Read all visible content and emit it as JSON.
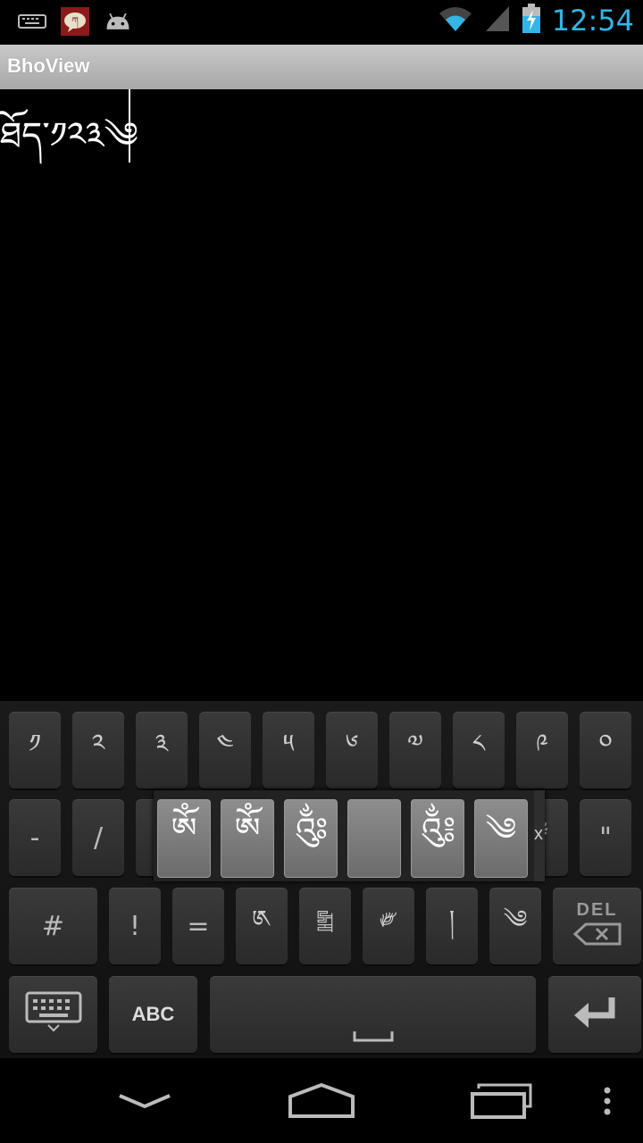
{
  "status_bar": {
    "time": "12:54",
    "icons": [
      "keyboard-icon",
      "chat-app-icon",
      "android-icon",
      "wifi-icon",
      "signal-icon",
      "battery-charging-icon"
    ]
  },
  "app": {
    "title": "BhoView"
  },
  "editor": {
    "text": "ཐོད་༡༢༣༄"
  },
  "keyboard": {
    "row1": [
      "༡",
      "༢",
      "༣",
      "༤",
      "༥",
      "༦",
      "༧",
      "༨",
      "༩",
      "༠"
    ],
    "row2_left": [
      "-",
      "/"
    ],
    "row2_right": [
      "༈",
      "\""
    ],
    "row3": [
      "#",
      "!",
      "=",
      "༁",
      "༖",
      "༗",
      "།",
      "༄"
    ],
    "del_label": "DEL",
    "abc_label": "ABC",
    "space_glyph": "␣",
    "enter_glyph": "↵"
  },
  "popup": {
    "keys": [
      "ཨོཾ",
      "ༀ",
      "༂",
      "",
      "༃",
      "༄"
    ],
    "close_label": "x"
  },
  "navbar": {
    "icons": [
      "back-icon",
      "home-icon",
      "recent-apps-icon",
      "menu-icon"
    ]
  }
}
